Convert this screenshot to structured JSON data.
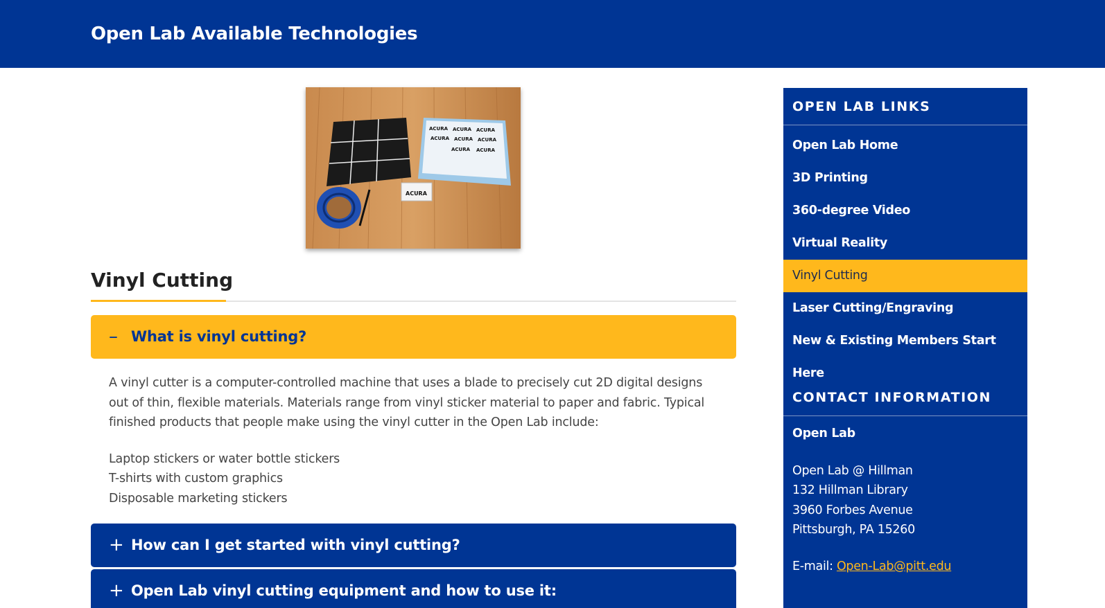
{
  "banner": {
    "title": "Open Lab Available Technologies"
  },
  "main": {
    "heading": "Vinyl Cutting",
    "accordion": [
      {
        "title": "What is vinyl cutting?",
        "state": "expanded",
        "sign": "–",
        "body": {
          "intro": "A vinyl cutter is a computer-controlled machine that uses a blade to precisely cut 2D digital designs out of thin, flexible materials. Materials range from vinyl sticker material to paper and fabric. Typical finished products that people make using the vinyl cutter in the Open Lab include:",
          "items": [
            "Laptop stickers or water bottle stickers",
            "T-shirts with custom graphics",
            "Disposable marketing stickers"
          ]
        }
      },
      {
        "title": "How can I get started with vinyl cutting?",
        "state": "collapsed",
        "sign": "+"
      },
      {
        "title": "Open Lab vinyl cutting equipment and how to use it:",
        "state": "collapsed",
        "sign": "+"
      }
    ],
    "image": {
      "sticker_text": "ACURA"
    }
  },
  "sidebar": {
    "links_heading": "OPEN LAB LINKS",
    "links": [
      {
        "label": "Open Lab Home",
        "active": false
      },
      {
        "label": "3D Printing",
        "active": false
      },
      {
        "label": "360-degree Video",
        "active": false
      },
      {
        "label": "Virtual Reality",
        "active": false
      },
      {
        "label": "Vinyl Cutting",
        "active": true
      },
      {
        "label": "Laser Cutting/Engraving",
        "active": false
      },
      {
        "label": "New & Existing Members Start Here",
        "active": false
      }
    ],
    "contact_heading": "CONTACT INFORMATION",
    "contact": {
      "name": "Open Lab",
      "address_lines": [
        "Open Lab @ Hillman",
        "132 Hillman Library",
        "3960 Forbes Avenue",
        "Pittsburgh, PA 15260"
      ],
      "email_label": "E-mail:",
      "email": "Open-Lab@pitt.edu"
    }
  },
  "colors": {
    "brand_blue": "#003594",
    "accent_gold": "#ffb81c"
  }
}
